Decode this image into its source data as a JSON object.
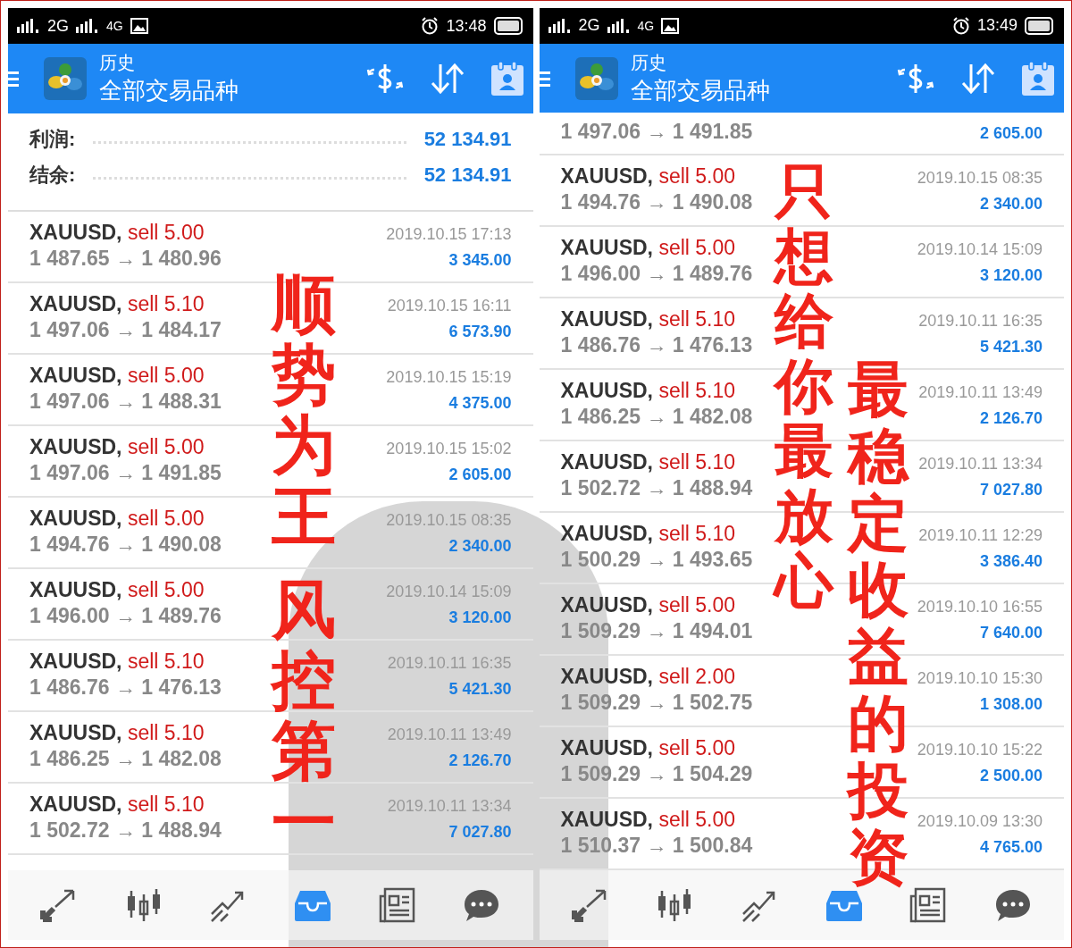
{
  "panels": [
    {
      "status_bar": {
        "network_1": "2G",
        "network_2": "4G",
        "time": "13:48"
      },
      "header": {
        "title": "历史",
        "subtitle": "全部交易品种"
      },
      "summary": [
        {
          "label": "利润:",
          "value": "52 134.91"
        },
        {
          "label": "结余:",
          "value": "52 134.91"
        }
      ],
      "trades": [
        {
          "kind": "full",
          "symbol": "XAUUSD,",
          "order": "sell 5.00",
          "time": "2019.10.15 17:13",
          "prices": "1 487.65 → 1 480.96",
          "profit": "3 345.00"
        },
        {
          "kind": "full",
          "symbol": "XAUUSD,",
          "order": "sell 5.10",
          "time": "2019.10.15 16:11",
          "prices": "1 497.06 → 1 484.17",
          "profit": "6 573.90"
        },
        {
          "kind": "full",
          "symbol": "XAUUSD,",
          "order": "sell 5.00",
          "time": "2019.10.15 15:19",
          "prices": "1 497.06 → 1 488.31",
          "profit": "4 375.00"
        },
        {
          "kind": "full",
          "symbol": "XAUUSD,",
          "order": "sell 5.00",
          "time": "2019.10.15 15:02",
          "prices": "1 497.06 → 1 491.85",
          "profit": "2 605.00"
        },
        {
          "kind": "full",
          "symbol": "XAUUSD,",
          "order": "sell 5.00",
          "time": "2019.10.15 08:35",
          "prices": "1 494.76 → 1 490.08",
          "profit": "2 340.00"
        },
        {
          "kind": "full",
          "symbol": "XAUUSD,",
          "order": "sell 5.00",
          "time": "2019.10.14 15:09",
          "prices": "1 496.00 → 1 489.76",
          "profit": "3 120.00"
        },
        {
          "kind": "full",
          "symbol": "XAUUSD,",
          "order": "sell 5.10",
          "time": "2019.10.11 16:35",
          "prices": "1 486.76 → 1 476.13",
          "profit": "5 421.30"
        },
        {
          "kind": "full",
          "symbol": "XAUUSD,",
          "order": "sell 5.10",
          "time": "2019.10.11 13:49",
          "prices": "1 486.25 → 1 482.08",
          "profit": "2 126.70"
        },
        {
          "kind": "full",
          "symbol": "XAUUSD,",
          "order": "sell 5.10",
          "time": "2019.10.11 13:34",
          "prices": "1 502.72 → 1 488.94",
          "profit": "7 027.80"
        }
      ],
      "nav": [
        {
          "kind": "trade",
          "selected": false
        },
        {
          "kind": "quotes",
          "selected": false
        },
        {
          "kind": "trend",
          "selected": false
        },
        {
          "kind": "history",
          "selected": true
        },
        {
          "kind": "news",
          "selected": false
        },
        {
          "kind": "chat",
          "selected": false
        }
      ]
    },
    {
      "status_bar": {
        "network_1": "2G",
        "network_2": "4G",
        "time": "13:49"
      },
      "header": {
        "title": "历史",
        "subtitle": "全部交易品种"
      },
      "trades": [
        {
          "kind": "clipped",
          "prices": "1 497.06 → 1 491.85",
          "profit": "2 605.00"
        },
        {
          "kind": "full",
          "symbol": "XAUUSD,",
          "order": "sell 5.00",
          "time": "2019.10.15 08:35",
          "prices": "1 494.76 → 1 490.08",
          "profit": "2 340.00"
        },
        {
          "kind": "full",
          "symbol": "XAUUSD,",
          "order": "sell 5.00",
          "time": "2019.10.14 15:09",
          "prices": "1 496.00 → 1 489.76",
          "profit": "3 120.00"
        },
        {
          "kind": "full",
          "symbol": "XAUUSD,",
          "order": "sell 5.10",
          "time": "2019.10.11 16:35",
          "prices": "1 486.76 → 1 476.13",
          "profit": "5 421.30"
        },
        {
          "kind": "full",
          "symbol": "XAUUSD,",
          "order": "sell 5.10",
          "time": "2019.10.11 13:49",
          "prices": "1 486.25 → 1 482.08",
          "profit": "2 126.70"
        },
        {
          "kind": "full",
          "symbol": "XAUUSD,",
          "order": "sell 5.10",
          "time": "2019.10.11 13:34",
          "prices": "1 502.72 → 1 488.94",
          "profit": "7 027.80"
        },
        {
          "kind": "full",
          "symbol": "XAUUSD,",
          "order": "sell 5.10",
          "time": "2019.10.11 12:29",
          "prices": "1 500.29 → 1 493.65",
          "profit": "3 386.40"
        },
        {
          "kind": "full",
          "symbol": "XAUUSD,",
          "order": "sell 5.00",
          "time": "2019.10.10 16:55",
          "prices": "1 509.29 → 1 494.01",
          "profit": "7 640.00"
        },
        {
          "kind": "full",
          "symbol": "XAUUSD,",
          "order": "sell 2.00",
          "time": "2019.10.10 15:30",
          "prices": "1 509.29 → 1 502.75",
          "profit": "1 308.00"
        },
        {
          "kind": "full",
          "symbol": "XAUUSD,",
          "order": "sell 5.00",
          "time": "2019.10.10 15:22",
          "prices": "1 509.29 → 1 504.29",
          "profit": "2 500.00"
        },
        {
          "kind": "full",
          "symbol": "XAUUSD,",
          "order": "sell 5.00",
          "time": "2019.10.09 13:30",
          "prices": "1 510.37 → 1 500.84",
          "profit": "4 765.00"
        }
      ],
      "nav": [
        {
          "kind": "trade",
          "selected": false
        },
        {
          "kind": "quotes",
          "selected": false
        },
        {
          "kind": "trend",
          "selected": false
        },
        {
          "kind": "history",
          "selected": true
        },
        {
          "kind": "news",
          "selected": false
        },
        {
          "kind": "chat",
          "selected": false
        }
      ]
    }
  ],
  "overlay_captions": [
    "顺势为王",
    "风控第一",
    "只想给你最放心",
    "最稳定收益的投资"
  ]
}
